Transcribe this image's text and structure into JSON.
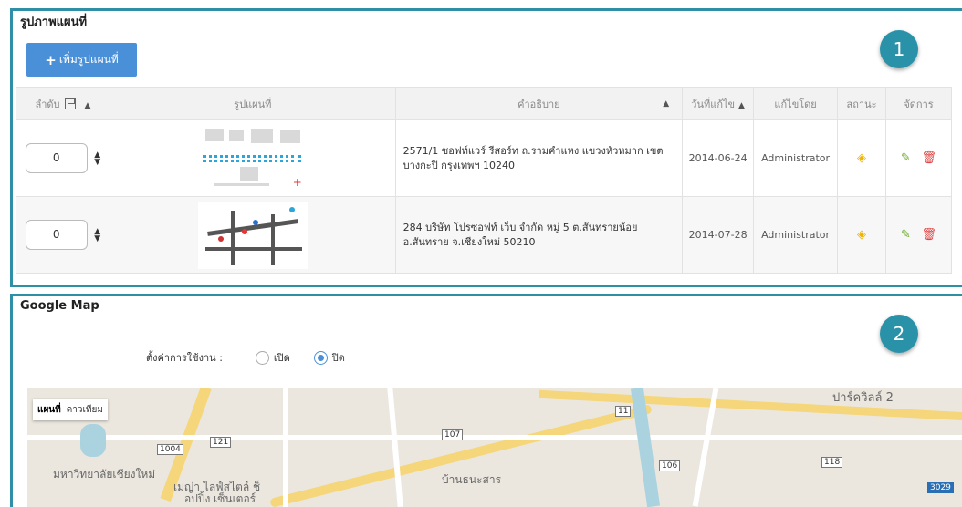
{
  "section1": {
    "title": "รูปภาพแผนที่",
    "add_button": "เพิ่มรูปแผนที่",
    "badge": "1",
    "columns": {
      "order": "ลำดับ",
      "image": "รูปแผนที่",
      "description": "คำอธิบาย",
      "modified": "วันที่แก้ไข",
      "modified_by": "แก้ไขโดย",
      "status": "สถานะ",
      "manage": "จัดการ"
    },
    "rows": [
      {
        "order": "0",
        "description": "2571/1 ซอฟท์แวร์ รีสอร์ท ถ.รามคำแหง แขวงหัวหมาก เขตบางกะปิ กรุงเทพฯ 10240",
        "date": "2014-06-24",
        "by": "Administrator"
      },
      {
        "order": "0",
        "description": "284 บริษัท โปรซอฟท์ เว็บ จำกัด หมู่ 5 ต.สันทรายน้อย อ.สันทราย จ.เชียงใหม่ 50210",
        "date": "2014-07-28",
        "by": "Administrator"
      }
    ]
  },
  "section2": {
    "title": "Google Map",
    "badge": "2",
    "setting_label": "ตั้งค่าการใช้งาน :",
    "option_on": "เปิด",
    "option_off": "ปิด",
    "map_type_map": "แผนที่",
    "map_type_satellite": "ดาวเทียม",
    "map_labels": {
      "park_villa": "ปาร์ควิลล์ 2",
      "cmu": "มหาวิทยาลัยเชียงใหม่",
      "maya": "เมญ่า ไลฟ์สไตล์ ช็",
      "shopping": "อปปิ้ง เซ็นเตอร์",
      "ban_thana": "บ้านธนะสาร",
      "shield_107": "107",
      "shield_11": "11",
      "shield_121": "121",
      "shield_1004": "1004",
      "shield_106": "106",
      "shield_118": "118",
      "shield_3029": "3029"
    }
  },
  "colors": {
    "accent_border": "#2f8fa6",
    "button_blue": "#4a90d9",
    "badge_teal": "#2a92a8",
    "eye_yellow": "#f0b400",
    "edit_green": "#6aaa2a",
    "delete_red": "#e04848"
  }
}
